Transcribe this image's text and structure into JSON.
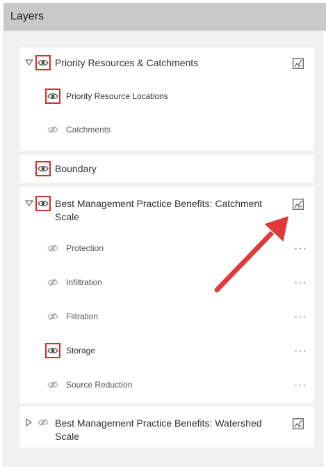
{
  "header": {
    "title": "Layers"
  },
  "colors": {
    "highlight_box": "#d92b2b",
    "arrow": "#e03a3a",
    "header_bg": "#c9c9c9",
    "panel_bg": "#f1f1f1"
  },
  "layers": {
    "group1": {
      "label": "Priority Resources & Catchments",
      "visible": true,
      "expanded": true,
      "children": [
        {
          "label": "Priority Resource Locations",
          "visible": true
        },
        {
          "label": "Catchments",
          "visible": false
        }
      ]
    },
    "boundary": {
      "label": "Boundary",
      "visible": true
    },
    "group2": {
      "label_line1": "Best Management Practice Benefits: Catchment",
      "label_line2": "Scale",
      "visible": true,
      "expanded": true,
      "children": [
        {
          "label": "Protection",
          "visible": false,
          "menu": "···"
        },
        {
          "label": "Infiltration",
          "visible": false,
          "menu": "···"
        },
        {
          "label": "Filtration",
          "visible": false,
          "menu": "···"
        },
        {
          "label": "Storage",
          "visible": true,
          "menu": "···"
        },
        {
          "label": "Source Reduction",
          "visible": false,
          "menu": "···"
        }
      ]
    },
    "group3": {
      "label_line1": "Best Management Practice Benefits: Watershed",
      "label_line2": "Scale",
      "visible": false,
      "expanded": false
    }
  },
  "icons": {
    "caret_expanded": "caret-down-icon",
    "caret_collapsed": "caret-right-icon",
    "eye_visible": "eye-icon",
    "eye_hidden": "eye-slash-icon",
    "legend": "legend-icon",
    "overflow_menu": "more-icon"
  }
}
